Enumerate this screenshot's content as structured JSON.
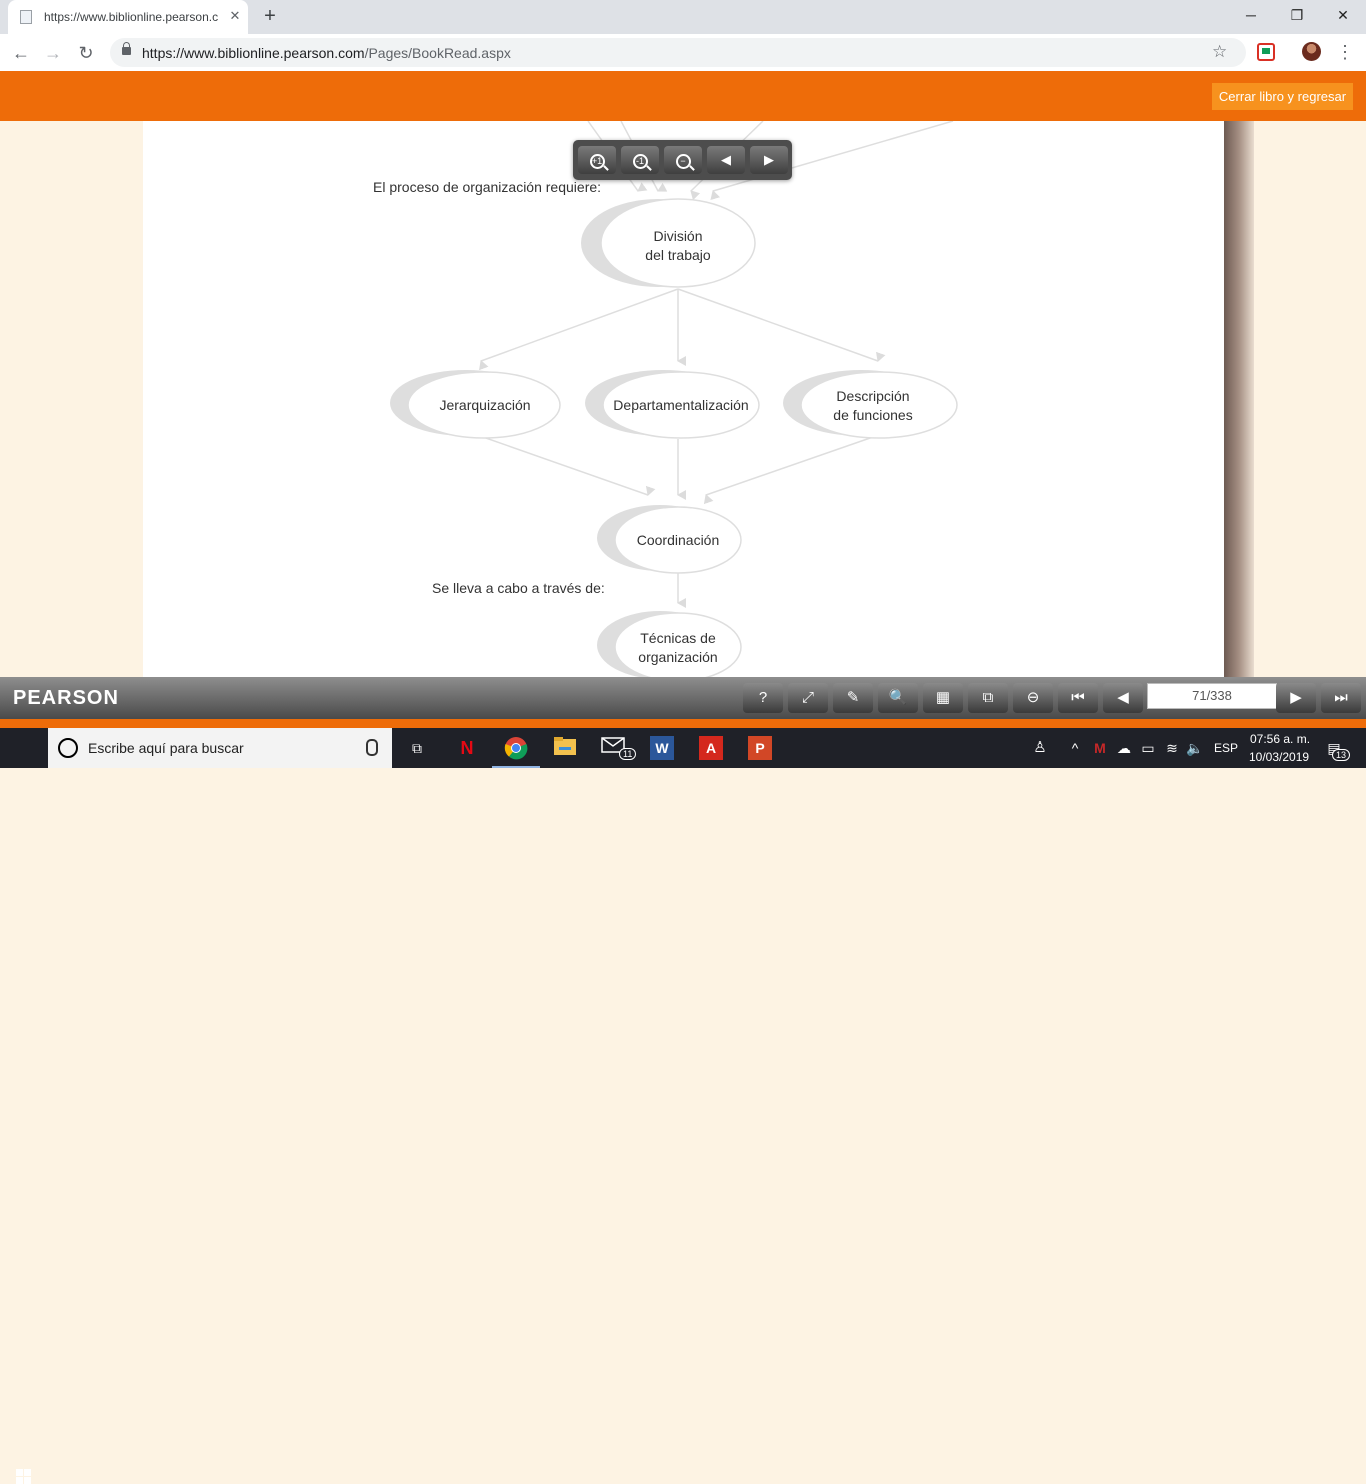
{
  "browser": {
    "tab_title": "https://www.biblionline.pearson.c",
    "tab_close": "✕",
    "new_tab": "+",
    "url_host": "https://www.biblionline.pearson.com",
    "url_path": "/Pages/BookRead.aspx",
    "window_controls": {
      "minimize": "─",
      "maximize": "❐",
      "close": "✕"
    },
    "nav": {
      "back": "←",
      "forward": "→",
      "reload": "↻"
    },
    "star": "☆",
    "menu": "⋮"
  },
  "reader": {
    "close_button": "Cerrar libro y regresar",
    "logo": "PEARSON",
    "page_indicator": "71/338",
    "zoom_buttons": {
      "zoom_in_label": "+1",
      "zoom_out_label": "-1",
      "prev": "◀",
      "next": "▶"
    },
    "footer_buttons": {
      "help": "?",
      "fullscreen": "⤢",
      "highlight": "✎",
      "search": "🔍",
      "grid": "▦",
      "fit": "⧉",
      "zoom_out": "⊖",
      "first": "⏮",
      "prev": "◀",
      "next": "▶",
      "last": "⏭"
    }
  },
  "page_content": {
    "intro": "El proceso de organización requiere:",
    "node_division": [
      "División",
      "del trabajo"
    ],
    "node_jerarquizacion": "Jerarquización",
    "node_departamentalizacion": "Departamentalización",
    "node_descripcion": [
      "Descripción",
      "de funciones"
    ],
    "node_coordinacion": "Coordinación",
    "via_text": "Se lleva a cabo a través de:",
    "node_tecnicas": [
      "Técnicas de",
      "organización"
    ]
  },
  "taskbar": {
    "search_placeholder": "Escribe aquí para buscar",
    "mail_badge": "11",
    "language": "ESP",
    "time": "07:56 a. m.",
    "date": "10/03/2019",
    "notifications": "13"
  },
  "colors": {
    "reader_orange": "#ee6c09",
    "button_orange": "#f7921e",
    "page_bg": "#fdf3e3",
    "taskbar": "#1f2128"
  }
}
